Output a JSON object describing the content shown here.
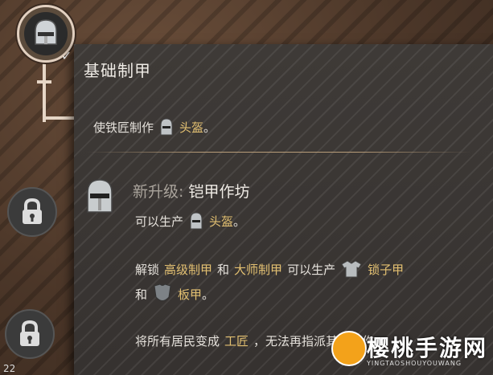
{
  "tooltip": {
    "title": "基础制甲",
    "desc_prefix": "使铁匠制作",
    "desc_item": "头盔",
    "desc_suffix": "。",
    "upgrade_label": "新升级:",
    "upgrade_name": "铠甲作坊",
    "produce_prefix": "可以生产",
    "produce_item": "头盔",
    "produce_suffix": "。",
    "unlock_prefix": "解锁",
    "unlock_item1": "高级制甲",
    "unlock_and": "和",
    "unlock_item2": "大师制甲",
    "unlock_mid": "可以生产",
    "unlock_item3": "锁子甲",
    "and2": "和",
    "unlock_item4": "板甲",
    "unlock_suffix": "。",
    "resident_prefix": "将所有居民变成",
    "resident_item": "工匠",
    "resident_suffix": "，无法再指派其他工作。"
  },
  "tree": {
    "bottom_counter": "22"
  },
  "watermark": {
    "name": "樱桃手游网",
    "sub": "YINGTAOSHOUYOUWANG"
  },
  "icons": {
    "main_node": "helmet-icon",
    "locked_nodes": "lock-icon",
    "completed": "checkmark-icon"
  },
  "colors": {
    "highlight": "#e3c071",
    "panel": "#3b3734",
    "text": "#e6e2dc"
  }
}
